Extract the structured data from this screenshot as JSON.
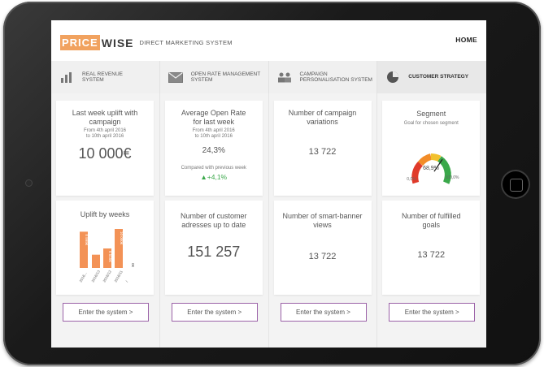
{
  "header": {
    "logo_price": "PRICE",
    "logo_wise": "WISE",
    "subtitle": "DIRECT MARKETING SYSTEM",
    "home": "HOME"
  },
  "tabs": [
    {
      "line1": "REAL REVENUE",
      "line2": "SYSTEM",
      "icon": "bar-chart-icon"
    },
    {
      "line1": "OPEN RATE MANAGEMENT",
      "line2": "SYSTEM",
      "icon": "envelope-icon"
    },
    {
      "line1": "CAMPAIGN",
      "line2": "PERSONALISATION SYSTEM",
      "icon": "users-icon"
    },
    {
      "line1": "CUSTOMER STRATEGY",
      "line2": "",
      "icon": "pie-chart-icon"
    }
  ],
  "col1": {
    "top": {
      "title_l1": "Last week uplift with",
      "title_l2": "campaign",
      "from": "From 4th april 2016",
      "to": "to 10th april 2016",
      "value": "10 000€"
    },
    "bottom": {
      "title": "Uplift by weeks"
    },
    "button": "Enter the system >"
  },
  "col2": {
    "top": {
      "title_l1": "Average Open Rate",
      "title_l2": "for last week",
      "from": "From 4th april 2016",
      "to": "to 10th april 2016",
      "value": "24,3%",
      "compared": "Compared with previous week",
      "change": "▲+4,1%"
    },
    "bottom": {
      "title_l1": "Number of customer",
      "title_l2": "adresses up to date",
      "value": "151 257"
    },
    "button": "Enter the system >"
  },
  "col3": {
    "top": {
      "title_l1": "Number of campaign",
      "title_l2": "variations",
      "value": "13 722"
    },
    "bottom": {
      "title_l1": "Number of smart-banner",
      "title_l2": "views",
      "value": "13 722"
    },
    "button": "Enter the system >"
  },
  "col4": {
    "top": {
      "title": "Segment",
      "subtitle": "Goal for chosen segment",
      "gauge_value": 68.9,
      "gauge_label": "68,9%",
      "gauge_min": "0,0%",
      "gauge_max": "100,0%"
    },
    "bottom": {
      "title_l1": "Number of fulfilled",
      "title_l2": "goals",
      "value": "13 722"
    },
    "button": "Enter the system >"
  },
  "colors": {
    "accent_orange": "#f1a25f",
    "bar_orange": "#f39256",
    "button_border": "#9b62a8",
    "green": "#3aa84a"
  },
  "chart_data": {
    "type": "bar",
    "title": "Uplift by weeks",
    "categories": [
      "2016...",
      "2016/13",
      "2016/12",
      "2016/11",
      "/"
    ],
    "values": [
      9.3,
      3.4,
      5.0,
      10.0,
      0
    ],
    "data_labels": [
      "8 999€",
      "",
      "6 515€",
      "10 000€",
      "0€"
    ]
  }
}
